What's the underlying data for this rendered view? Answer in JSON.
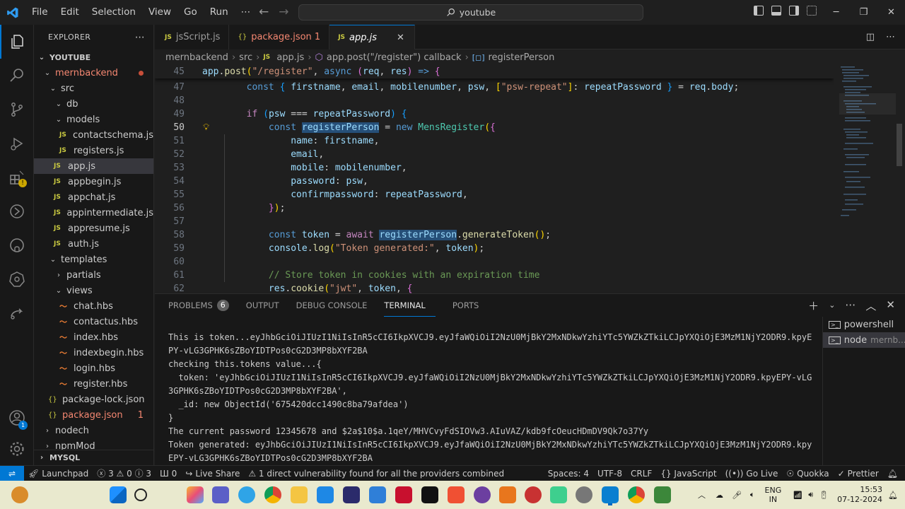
{
  "menu": [
    "File",
    "Edit",
    "Selection",
    "View",
    "Go",
    "Run",
    "⋯"
  ],
  "search": {
    "text": "youtube"
  },
  "explorer": {
    "title": "EXPLORER",
    "root": "YOUTUBE",
    "rows": [
      {
        "label": "mernbackend",
        "kind": "folder",
        "open": true,
        "depth": 1,
        "color": "red",
        "dot": true
      },
      {
        "label": "src",
        "kind": "folder",
        "open": true,
        "depth": 2
      },
      {
        "label": "db",
        "kind": "folder",
        "open": true,
        "depth": 3
      },
      {
        "label": "models",
        "kind": "folder",
        "open": true,
        "depth": 3
      },
      {
        "label": "contactschema.js",
        "kind": "js",
        "depth": 4
      },
      {
        "label": "registers.js",
        "kind": "js",
        "depth": 4
      },
      {
        "label": "app.js",
        "kind": "js",
        "depth": 3,
        "selected": true
      },
      {
        "label": "appbegin.js",
        "kind": "js",
        "depth": 3
      },
      {
        "label": "appchat.js",
        "kind": "js",
        "depth": 3
      },
      {
        "label": "appintermediate.js",
        "kind": "js",
        "depth": 3
      },
      {
        "label": "appresume.js",
        "kind": "js",
        "depth": 3
      },
      {
        "label": "auth.js",
        "kind": "js",
        "depth": 3
      },
      {
        "label": "templates",
        "kind": "folder",
        "open": true,
        "depth": 2
      },
      {
        "label": "partials",
        "kind": "folder",
        "open": false,
        "depth": 3
      },
      {
        "label": "views",
        "kind": "folder",
        "open": true,
        "depth": 3
      },
      {
        "label": "chat.hbs",
        "kind": "hbs",
        "depth": 4
      },
      {
        "label": "contactus.hbs",
        "kind": "hbs",
        "depth": 4
      },
      {
        "label": "index.hbs",
        "kind": "hbs",
        "depth": 4
      },
      {
        "label": "indexbegin.hbs",
        "kind": "hbs",
        "depth": 4
      },
      {
        "label": "login.hbs",
        "kind": "hbs",
        "depth": 4
      },
      {
        "label": "register.hbs",
        "kind": "hbs",
        "depth": 4
      },
      {
        "label": "package-lock.json",
        "kind": "json",
        "depth": 2
      },
      {
        "label": "package.json",
        "kind": "json",
        "depth": 2,
        "color": "red",
        "count": "1"
      },
      {
        "label": "nodech",
        "kind": "folder",
        "open": false,
        "depth": 1
      },
      {
        "label": "npmMod",
        "kind": "folder",
        "open": false,
        "depth": 1
      }
    ],
    "mysql": "MYSQL"
  },
  "tabs": [
    {
      "label": "jsScript.js",
      "icon": "JS"
    },
    {
      "label": "package.json 1",
      "icon": "{}",
      "color": "red"
    },
    {
      "label": "app.js",
      "icon": "JS",
      "active": true,
      "close": "✕"
    }
  ],
  "breadcrumb": [
    "mernbackend",
    "src",
    "app.js",
    "app.post(\"/register\") callback",
    "registerPerson"
  ],
  "code_lines": [
    {
      "n": "45",
      "sticky": true,
      "segs": [
        [
          "var",
          "app"
        ],
        [
          "pun",
          "."
        ],
        [
          "fn",
          "post"
        ],
        [
          "br1",
          "("
        ],
        [
          "str",
          "\"/register\""
        ],
        [
          "pun",
          ", "
        ],
        [
          "kw",
          "async"
        ],
        [
          "pun",
          " "
        ],
        [
          "br2",
          "("
        ],
        [
          "var",
          "req"
        ],
        [
          "pun",
          ", "
        ],
        [
          "var",
          "res"
        ],
        [
          "br2",
          ")"
        ],
        [
          "pun",
          " "
        ],
        [
          "kw",
          "=>"
        ],
        [
          "pun",
          " "
        ],
        [
          "br2",
          "{"
        ]
      ]
    },
    {
      "n": "47",
      "segs": [
        [
          "pun",
          "        "
        ],
        [
          "kw",
          "const"
        ],
        [
          "pun",
          " "
        ],
        [
          "br3",
          "{"
        ],
        [
          "pun",
          " "
        ],
        [
          "var",
          "firstname"
        ],
        [
          "pun",
          ", "
        ],
        [
          "var",
          "email"
        ],
        [
          "pun",
          ", "
        ],
        [
          "var",
          "mobilenumber"
        ],
        [
          "pun",
          ", "
        ],
        [
          "var",
          "psw"
        ],
        [
          "pun",
          ", "
        ],
        [
          "br1",
          "["
        ],
        [
          "str",
          "\"psw-repeat\""
        ],
        [
          "br1",
          "]"
        ],
        [
          "pun",
          ": "
        ],
        [
          "var",
          "repeatPassword"
        ],
        [
          "pun",
          " "
        ],
        [
          "br3",
          "}"
        ],
        [
          "pun",
          " = "
        ],
        [
          "var",
          "req"
        ],
        [
          "pun",
          "."
        ],
        [
          "var",
          "body"
        ],
        [
          "pun",
          ";"
        ]
      ]
    },
    {
      "n": "48",
      "segs": []
    },
    {
      "n": "49",
      "segs": [
        [
          "pun",
          "        "
        ],
        [
          "ctl",
          "if"
        ],
        [
          "pun",
          " "
        ],
        [
          "br3",
          "("
        ],
        [
          "var",
          "psw"
        ],
        [
          "pun",
          " === "
        ],
        [
          "var",
          "repeatPassword"
        ],
        [
          "br3",
          ")"
        ],
        [
          "pun",
          " "
        ],
        [
          "br3",
          "{"
        ]
      ]
    },
    {
      "n": "50",
      "cur": true,
      "bulb": true,
      "segs": [
        [
          "pun",
          "            "
        ],
        [
          "kw",
          "const"
        ],
        [
          "pun",
          " "
        ],
        [
          "var hl",
          "registerPerson"
        ],
        [
          "pun",
          " = "
        ],
        [
          "kw",
          "new"
        ],
        [
          "pun",
          " "
        ],
        [
          "cls",
          "MensRegister"
        ],
        [
          "br1",
          "("
        ],
        [
          "br2",
          "{"
        ]
      ]
    },
    {
      "n": "51",
      "segs": [
        [
          "pun",
          "                "
        ],
        [
          "var",
          "name"
        ],
        [
          "pun",
          ": "
        ],
        [
          "var",
          "firstname"
        ],
        [
          "pun",
          ","
        ]
      ]
    },
    {
      "n": "52",
      "segs": [
        [
          "pun",
          "                "
        ],
        [
          "var",
          "email"
        ],
        [
          "pun",
          ","
        ]
      ]
    },
    {
      "n": "53",
      "segs": [
        [
          "pun",
          "                "
        ],
        [
          "var",
          "mobile"
        ],
        [
          "pun",
          ": "
        ],
        [
          "var",
          "mobilenumber"
        ],
        [
          "pun",
          ","
        ]
      ]
    },
    {
      "n": "54",
      "segs": [
        [
          "pun",
          "                "
        ],
        [
          "var",
          "password"
        ],
        [
          "pun",
          ": "
        ],
        [
          "var",
          "psw"
        ],
        [
          "pun",
          ","
        ]
      ]
    },
    {
      "n": "55",
      "segs": [
        [
          "pun",
          "                "
        ],
        [
          "var",
          "confirmpassword"
        ],
        [
          "pun",
          ": "
        ],
        [
          "var",
          "repeatPassword"
        ],
        [
          "pun",
          ","
        ]
      ]
    },
    {
      "n": "56",
      "segs": [
        [
          "pun",
          "            "
        ],
        [
          "br2",
          "}"
        ],
        [
          "br1",
          ")"
        ],
        [
          "pun",
          ";"
        ]
      ]
    },
    {
      "n": "57",
      "segs": []
    },
    {
      "n": "58",
      "segs": [
        [
          "pun",
          "            "
        ],
        [
          "kw",
          "const"
        ],
        [
          "pun",
          " "
        ],
        [
          "var",
          "token"
        ],
        [
          "pun",
          " = "
        ],
        [
          "ctl",
          "await"
        ],
        [
          "pun",
          " "
        ],
        [
          "var hl",
          "registerPerson"
        ],
        [
          "pun",
          "."
        ],
        [
          "fn",
          "generateToken"
        ],
        [
          "br1",
          "()"
        ],
        [
          "pun",
          ";"
        ]
      ]
    },
    {
      "n": "59",
      "segs": [
        [
          "pun",
          "            "
        ],
        [
          "var",
          "console"
        ],
        [
          "pun",
          "."
        ],
        [
          "fn",
          "log"
        ],
        [
          "br1",
          "("
        ],
        [
          "str",
          "\"Token generated:\""
        ],
        [
          "pun",
          ", "
        ],
        [
          "var",
          "token"
        ],
        [
          "br1",
          ")"
        ],
        [
          "pun",
          ";"
        ]
      ]
    },
    {
      "n": "60",
      "segs": []
    },
    {
      "n": "61",
      "segs": [
        [
          "pun",
          "            "
        ],
        [
          "cm",
          "// Store token in cookies with an expiration time"
        ]
      ]
    },
    {
      "n": "62",
      "segs": [
        [
          "pun",
          "            "
        ],
        [
          "var",
          "res"
        ],
        [
          "pun",
          "."
        ],
        [
          "fn",
          "cookie"
        ],
        [
          "br1",
          "("
        ],
        [
          "str",
          "\"jwt\""
        ],
        [
          "pun",
          ", "
        ],
        [
          "var",
          "token"
        ],
        [
          "pun",
          ", "
        ],
        [
          "br2",
          "{"
        ]
      ]
    }
  ],
  "panel": {
    "tabs": [
      {
        "label": "PROBLEMS",
        "count": "6"
      },
      {
        "label": "OUTPUT"
      },
      {
        "label": "DEBUG CONSOLE"
      },
      {
        "label": "TERMINAL",
        "active": true
      },
      {
        "label": "PORTS"
      }
    ],
    "terminal_lines": [
      "This is token...eyJhbGciOiJIUzI1NiIsInR5cCI6IkpXVCJ9.eyJfaWQiOiI2NzU0MjBkY2MxNDkwYzhiYTc5YWZkZTkiLCJpYXQiOjE3MzM1NjY2ODR9.kpyE",
      "PY-vLG3GPHK6sZBoYIDTPos0cG2D3MP8bXYF2BA",
      "checking this.tokens value...{",
      "  token: 'eyJhbGciOiJIUzI1NiIsInR5cCI6IkpXVCJ9.eyJfaWQiOiI2NzU0MjBkY2MxNDkwYzhiYTc5YWZkZTkiLCJpYXQiOjE3MzM1NjY2ODR9.kpyEPY-vLG",
      "3GPHK6sZBoYIDTPos0cG2D3MP8bXYF2BA',",
      "  _id: new ObjectId('675420dcc1490c8ba79afdea')",
      "}",
      "The current password 12345678 and $2a$10$a.1qeY/MHVCvyFdSIOVw3.AIuVAZ/kdb9fcOeucHDmDV9Qk7o37Yy",
      "Token generated: eyJhbGciOiJIUzI1NiIsInR5cCI6IkpXVCJ9.eyJfaWQiOiI2NzU0MjBkY2MxNDkwYzhiYTc5YWZkZTkiLCJpYXQiOjE3MzM1NjY2ODR9.kpy",
      "EPY-vLG3GPHK6sZBoYIDTPos0cG2D3MP8bXYF2BA"
    ],
    "terminals": [
      {
        "label": "powershell"
      },
      {
        "label": "node",
        "sub": "mernb..."
      }
    ]
  },
  "status": {
    "left": [
      "Launchpad",
      "ⓧ 3 ⚠ 0 ⓘ 3",
      "Ш 0",
      "Live Share",
      "⚠ 1 direct vulnerability found for all the providers combined"
    ],
    "right": [
      "Spaces: 4",
      "UTF-8",
      "CRLF",
      "{} JavaScript",
      "Go Live",
      "Quokka",
      "Prettier"
    ]
  },
  "tray": {
    "lang1": "ENG",
    "lang2": "IN",
    "time": "15:53",
    "date": "07-12-2024"
  },
  "colors": {
    "accent": "#0078d4",
    "editor_bg": "#1f1f1f",
    "sidebar_bg": "#181818",
    "taskbar_bg": "#e9e9ce"
  }
}
